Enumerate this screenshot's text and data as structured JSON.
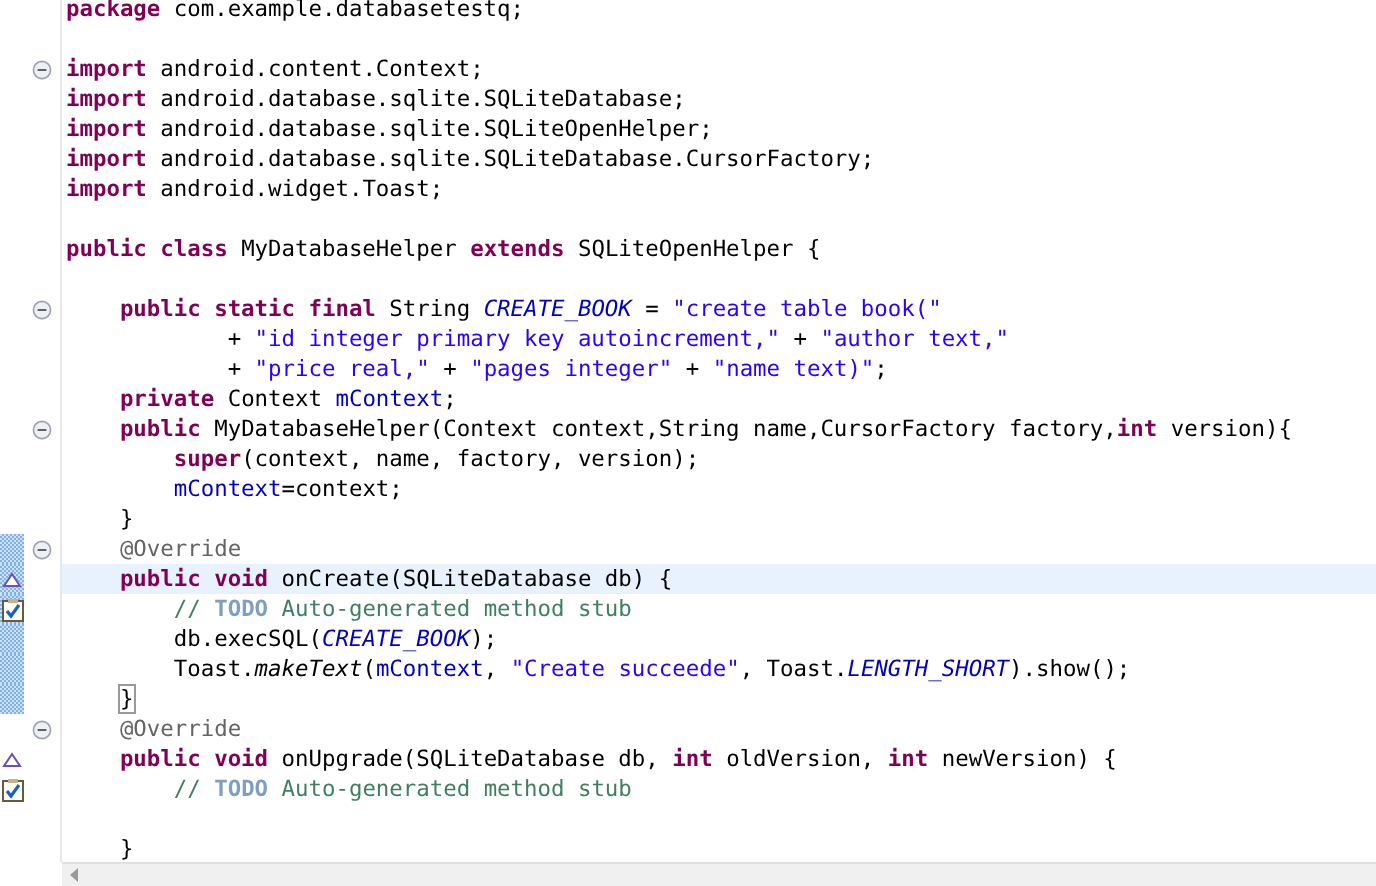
{
  "editor": {
    "lines": [
      {
        "kind": "code",
        "tokens": [
          {
            "kind": "keyword",
            "text": "package"
          },
          {
            "kind": "plain",
            "text": " com.example.databasetestq;"
          }
        ]
      },
      {
        "kind": "blank"
      },
      {
        "kind": "code",
        "fold": true,
        "tokens": [
          {
            "kind": "keyword",
            "text": "import"
          },
          {
            "kind": "plain",
            "text": " android.content.Context;"
          }
        ]
      },
      {
        "kind": "code",
        "tokens": [
          {
            "kind": "keyword",
            "text": "import"
          },
          {
            "kind": "plain",
            "text": " android.database.sqlite.SQLiteDatabase;"
          }
        ]
      },
      {
        "kind": "code",
        "tokens": [
          {
            "kind": "keyword",
            "text": "import"
          },
          {
            "kind": "plain",
            "text": " android.database.sqlite.SQLiteOpenHelper;"
          }
        ]
      },
      {
        "kind": "code",
        "tokens": [
          {
            "kind": "keyword",
            "text": "import"
          },
          {
            "kind": "plain",
            "text": " android.database.sqlite.SQLiteDatabase.CursorFactory;"
          }
        ]
      },
      {
        "kind": "code",
        "tokens": [
          {
            "kind": "keyword",
            "text": "import"
          },
          {
            "kind": "plain",
            "text": " android.widget.Toast;"
          }
        ]
      },
      {
        "kind": "blank"
      },
      {
        "kind": "code",
        "tokens": [
          {
            "kind": "keyword",
            "text": "public class"
          },
          {
            "kind": "plain",
            "text": " MyDatabaseHelper "
          },
          {
            "kind": "keyword",
            "text": "extends"
          },
          {
            "kind": "plain",
            "text": " SQLiteOpenHelper {"
          }
        ]
      },
      {
        "kind": "blank"
      },
      {
        "kind": "code",
        "fold": true,
        "tokens": [
          {
            "kind": "keyword",
            "text": "    public static final"
          },
          {
            "kind": "plain",
            "text": " String "
          },
          {
            "kind": "static",
            "text": "CREATE_BOOK"
          },
          {
            "kind": "plain",
            "text": " = "
          },
          {
            "kind": "string",
            "text": "\"create table book(\""
          }
        ]
      },
      {
        "kind": "code",
        "tokens": [
          {
            "kind": "plain",
            "text": "            + "
          },
          {
            "kind": "string",
            "text": "\"id integer primary key autoincrement,\""
          },
          {
            "kind": "plain",
            "text": " + "
          },
          {
            "kind": "string",
            "text": "\"author text,\""
          }
        ]
      },
      {
        "kind": "code",
        "tokens": [
          {
            "kind": "plain",
            "text": "            + "
          },
          {
            "kind": "string",
            "text": "\"price real,\""
          },
          {
            "kind": "plain",
            "text": " + "
          },
          {
            "kind": "string",
            "text": "\"pages integer\""
          },
          {
            "kind": "plain",
            "text": " + "
          },
          {
            "kind": "string",
            "text": "\"name text)\""
          },
          {
            "kind": "plain",
            "text": ";"
          }
        ]
      },
      {
        "kind": "code",
        "tokens": [
          {
            "kind": "keyword",
            "text": "    private"
          },
          {
            "kind": "plain",
            "text": " Context "
          },
          {
            "kind": "field",
            "text": "mContext"
          },
          {
            "kind": "plain",
            "text": ";"
          }
        ]
      },
      {
        "kind": "code",
        "fold": true,
        "tokens": [
          {
            "kind": "keyword",
            "text": "    public"
          },
          {
            "kind": "plain",
            "text": " MyDatabaseHelper(Context context,String name,CursorFactory factory,"
          },
          {
            "kind": "keyword",
            "text": "int"
          },
          {
            "kind": "plain",
            "text": " version){"
          }
        ]
      },
      {
        "kind": "code",
        "tokens": [
          {
            "kind": "keyword",
            "text": "        super"
          },
          {
            "kind": "plain",
            "text": "(context, name, factory, version);"
          }
        ]
      },
      {
        "kind": "code",
        "tokens": [
          {
            "kind": "field",
            "text": "        mContext"
          },
          {
            "kind": "plain",
            "text": "=context;"
          }
        ]
      },
      {
        "kind": "code",
        "tokens": [
          {
            "kind": "plain",
            "text": "    }"
          }
        ]
      },
      {
        "kind": "code",
        "fold": true,
        "in_range": true,
        "tokens": [
          {
            "kind": "annotation",
            "text": "    @Override"
          }
        ]
      },
      {
        "kind": "code",
        "highlighted": true,
        "in_range": true,
        "marker": {
          "kind": "override"
        },
        "tokens": [
          {
            "kind": "keyword",
            "text": "    public void"
          },
          {
            "kind": "plain",
            "text": " onCreate(SQLiteDatabase db) {"
          }
        ]
      },
      {
        "kind": "code",
        "in_range": true,
        "marker": {
          "kind": "task"
        },
        "tokens": [
          {
            "kind": "comment",
            "text": "        // "
          },
          {
            "kind": "todo",
            "text": "TODO"
          },
          {
            "kind": "comment",
            "text": " Auto-generated method stub"
          }
        ]
      },
      {
        "kind": "code",
        "in_range": true,
        "tokens": [
          {
            "kind": "plain",
            "text": "        db.execSQL("
          },
          {
            "kind": "static",
            "text": "CREATE_BOOK"
          },
          {
            "kind": "plain",
            "text": ");"
          }
        ]
      },
      {
        "kind": "code",
        "in_range": true,
        "tokens": [
          {
            "kind": "plain",
            "text": "        Toast."
          },
          {
            "kind": "method",
            "text": "makeText"
          },
          {
            "kind": "plain",
            "text": "("
          },
          {
            "kind": "field",
            "text": "mContext"
          },
          {
            "kind": "plain",
            "text": ", "
          },
          {
            "kind": "string",
            "text": "\"Create succeede\""
          },
          {
            "kind": "plain",
            "text": ", Toast."
          },
          {
            "kind": "static",
            "text": "LENGTH_SHORT"
          },
          {
            "kind": "plain",
            "text": ").show();"
          }
        ]
      },
      {
        "kind": "code",
        "in_range": true,
        "tokens": [
          {
            "kind": "match",
            "text": "    }"
          }
        ]
      },
      {
        "kind": "code",
        "fold": true,
        "tokens": [
          {
            "kind": "annotation",
            "text": "    @Override"
          }
        ]
      },
      {
        "kind": "code",
        "marker": {
          "kind": "override"
        },
        "tokens": [
          {
            "kind": "keyword",
            "text": "    public void"
          },
          {
            "kind": "plain",
            "text": " onUpgrade(SQLiteDatabase db, "
          },
          {
            "kind": "keyword",
            "text": "int"
          },
          {
            "kind": "plain",
            "text": " oldVersion, "
          },
          {
            "kind": "keyword",
            "text": "int"
          },
          {
            "kind": "plain",
            "text": " newVersion) {"
          }
        ]
      },
      {
        "kind": "code",
        "marker": {
          "kind": "task"
        },
        "tokens": [
          {
            "kind": "comment",
            "text": "        // "
          },
          {
            "kind": "todo",
            "text": "TODO"
          },
          {
            "kind": "comment",
            "text": " Auto-generated method stub"
          }
        ]
      },
      {
        "kind": "blank"
      },
      {
        "kind": "code",
        "tokens": [
          {
            "kind": "plain",
            "text": "    }"
          }
        ]
      }
    ]
  }
}
